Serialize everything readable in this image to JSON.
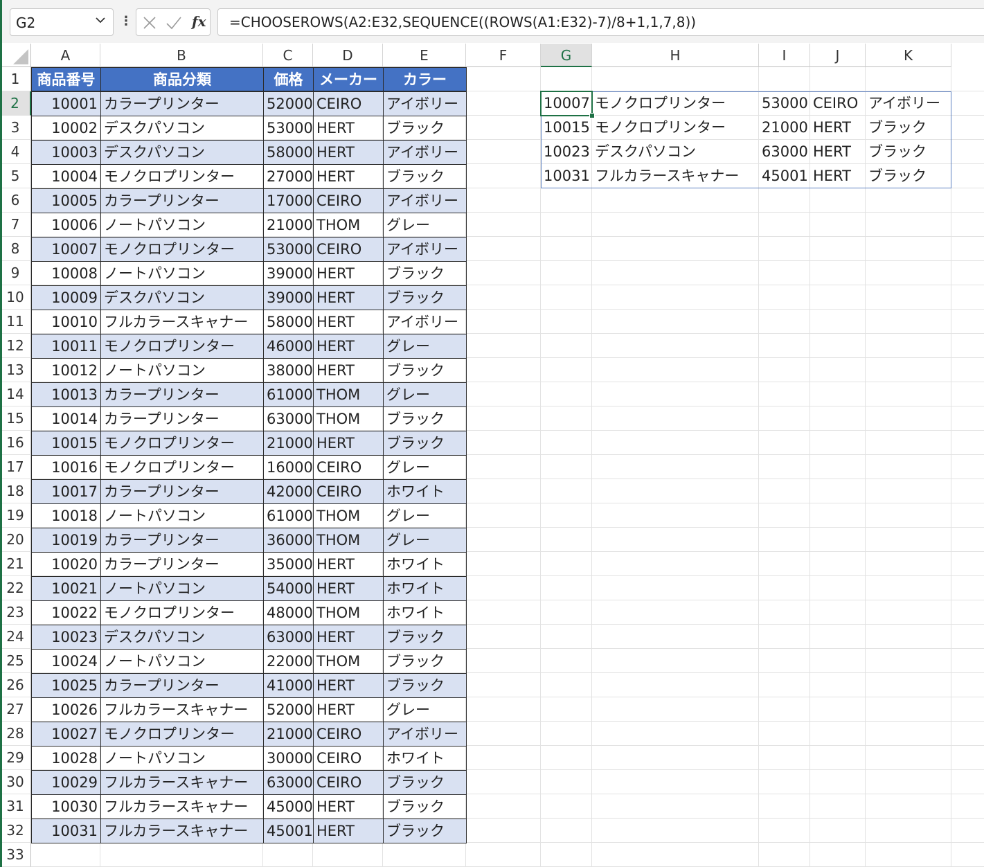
{
  "formula_bar": {
    "name_box": "G2",
    "fx_label": "fx",
    "formula": "=CHOOSEROWS(A2:E32,SEQUENCE((ROWS(A1:E32)-7)/8+1,1,7,8))"
  },
  "columns": [
    "A",
    "B",
    "C",
    "D",
    "E",
    "F",
    "G",
    "H",
    "I",
    "J",
    "K"
  ],
  "selected_column": "G",
  "selected_row": 2,
  "row_numbers": [
    "1",
    "2",
    "3",
    "4",
    "5",
    "6",
    "7",
    "8",
    "9",
    "10",
    "11",
    "12",
    "13",
    "14",
    "15",
    "16",
    "17",
    "18",
    "19",
    "20",
    "21",
    "22",
    "23",
    "24",
    "25",
    "26",
    "27",
    "28",
    "29",
    "30",
    "31",
    "32",
    "33"
  ],
  "table": {
    "headers": [
      "商品番号",
      "商品分類",
      "価格",
      "メーカー",
      "カラー"
    ],
    "rows": [
      [
        "10001",
        "カラープリンター",
        "52000",
        "CEIRO",
        "アイボリー"
      ],
      [
        "10002",
        "デスクパソコン",
        "53000",
        "HERT",
        "ブラック"
      ],
      [
        "10003",
        "デスクパソコン",
        "58000",
        "HERT",
        "アイボリー"
      ],
      [
        "10004",
        "モノクロプリンター",
        "27000",
        "HERT",
        "ブラック"
      ],
      [
        "10005",
        "カラープリンター",
        "17000",
        "CEIRO",
        "アイボリー"
      ],
      [
        "10006",
        "ノートパソコン",
        "21000",
        "THOM",
        "グレー"
      ],
      [
        "10007",
        "モノクロプリンター",
        "53000",
        "CEIRO",
        "アイボリー"
      ],
      [
        "10008",
        "ノートパソコン",
        "39000",
        "HERT",
        "ブラック"
      ],
      [
        "10009",
        "デスクパソコン",
        "39000",
        "HERT",
        "ブラック"
      ],
      [
        "10010",
        "フルカラースキャナー",
        "58000",
        "HERT",
        "アイボリー"
      ],
      [
        "10011",
        "モノクロプリンター",
        "46000",
        "HERT",
        "グレー"
      ],
      [
        "10012",
        "ノートパソコン",
        "38000",
        "HERT",
        "ブラック"
      ],
      [
        "10013",
        "カラープリンター",
        "61000",
        "THOM",
        "グレー"
      ],
      [
        "10014",
        "カラープリンター",
        "63000",
        "THOM",
        "ブラック"
      ],
      [
        "10015",
        "モノクロプリンター",
        "21000",
        "HERT",
        "ブラック"
      ],
      [
        "10016",
        "モノクロプリンター",
        "16000",
        "CEIRO",
        "グレー"
      ],
      [
        "10017",
        "カラープリンター",
        "42000",
        "CEIRO",
        "ホワイト"
      ],
      [
        "10018",
        "ノートパソコン",
        "61000",
        "THOM",
        "グレー"
      ],
      [
        "10019",
        "カラープリンター",
        "36000",
        "THOM",
        "グレー"
      ],
      [
        "10020",
        "カラープリンター",
        "35000",
        "HERT",
        "ホワイト"
      ],
      [
        "10021",
        "ノートパソコン",
        "54000",
        "HERT",
        "ホワイト"
      ],
      [
        "10022",
        "モノクロプリンター",
        "48000",
        "THOM",
        "ホワイト"
      ],
      [
        "10023",
        "デスクパソコン",
        "63000",
        "HERT",
        "ブラック"
      ],
      [
        "10024",
        "ノートパソコン",
        "22000",
        "THOM",
        "ブラック"
      ],
      [
        "10025",
        "カラープリンター",
        "41000",
        "HERT",
        "ブラック"
      ],
      [
        "10026",
        "フルカラースキャナー",
        "52000",
        "HERT",
        "グレー"
      ],
      [
        "10027",
        "モノクロプリンター",
        "21000",
        "CEIRO",
        "アイボリー"
      ],
      [
        "10028",
        "ノートパソコン",
        "30000",
        "CEIRO",
        "ホワイト"
      ],
      [
        "10029",
        "フルカラースキャナー",
        "63000",
        "CEIRO",
        "ブラック"
      ],
      [
        "10030",
        "フルカラースキャナー",
        "45000",
        "HERT",
        "ブラック"
      ],
      [
        "10031",
        "フルカラースキャナー",
        "45001",
        "HERT",
        "ブラック"
      ]
    ]
  },
  "result": {
    "rows": [
      [
        "10007",
        "モノクロプリンター",
        "53000",
        "CEIRO",
        "アイボリー"
      ],
      [
        "10015",
        "モノクロプリンター",
        "21000",
        "HERT",
        "ブラック"
      ],
      [
        "10023",
        "デスクパソコン",
        "63000",
        "HERT",
        "ブラック"
      ],
      [
        "10031",
        "フルカラースキャナー",
        "45001",
        "HERT",
        "ブラック"
      ]
    ]
  },
  "colors": {
    "header_fill": "#4472c4",
    "band_fill": "#d9e1f2",
    "excel_green": "#1e7145"
  }
}
